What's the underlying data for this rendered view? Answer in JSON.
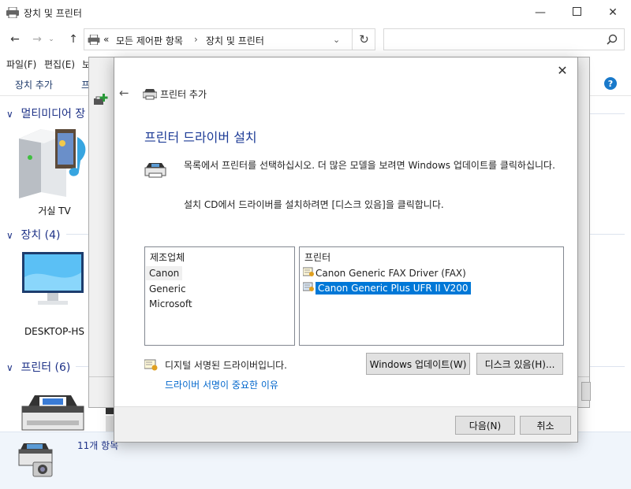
{
  "window": {
    "title": "장치 및 프린터"
  },
  "address": {
    "prefix": "«",
    "crumbs": [
      "모든 제어판 항목",
      "장치 및 프린터"
    ],
    "separator": "›"
  },
  "menu": {
    "file": "파일(F)",
    "edit": "편집(E)",
    "view": "보기(V)"
  },
  "command_bar": {
    "add_device": "장치 추가",
    "add_printer_partial": "프"
  },
  "groups": {
    "multimedia": {
      "label": "멀티미디어 장"
    },
    "devices": {
      "label": "장치 (4)"
    },
    "printers": {
      "label": "프린터 (6)"
    }
  },
  "devices": {
    "living_tv": "거실 TV",
    "desktop": "DESKTOP-HS"
  },
  "status": {
    "item_count": "11개 항목"
  },
  "dialog": {
    "title": "프린터 추가",
    "heading": "프린터 드라이버 설치",
    "desc1": "목록에서 프린터를 선택하십시오. 더 많은 모델을 보려면 Windows 업데이트를 클릭하십니다.",
    "desc2": "설치 CD에서 드라이버를 설치하려면 [디스크 있음]을 클릭합니다.",
    "manufacturer_header": "제조업체",
    "manufacturers": [
      "Canon",
      "Generic",
      "Microsoft"
    ],
    "printer_header": "프린터",
    "printers": [
      "Canon Generic FAX Driver (FAX)",
      "Canon Generic Plus UFR II V200"
    ],
    "signed_text": "디지털 서명된 드라이버입니다.",
    "signed_link": "드라이버 서명이 중요한 이유",
    "windows_update_button": "Windows 업데이트(W)",
    "have_disk_button": "디스크 있음(H)...",
    "next_button": "다음(N)",
    "cancel_button": "취소"
  },
  "colors": {
    "heading_blue": "#1d3b96",
    "selection_blue": "#0078d7",
    "link_blue": "#0066cc",
    "status_bg": "#f0f5fb"
  }
}
